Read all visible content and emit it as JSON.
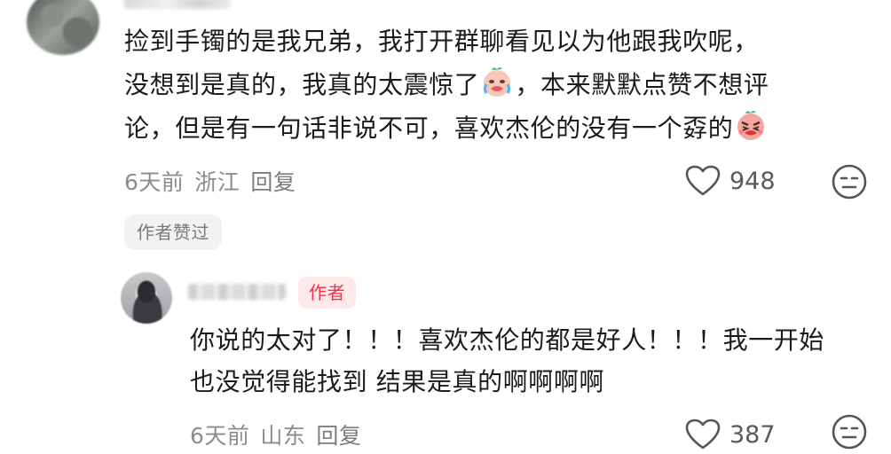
{
  "comment": {
    "line1": "捡到手镯的是我兄弟，我打开群聊看见以为他跟我吹呢，",
    "line2a": "没想到是真的，我真的太震惊了",
    "line2b": "，本来默默点赞不想评",
    "line3a": "论，但是有一句话非说不可，喜欢杰伦的没有一个孬的",
    "time": "6天前",
    "location": "浙江",
    "reply_label": "回复",
    "likes": "948",
    "author_liked_badge": "作者赞过",
    "emoji1": "crying-face",
    "emoji2": "angry-face"
  },
  "reply": {
    "author_tag": "作者",
    "line1": "你说的太对了！！！喜欢杰伦的都是好人！！！我一开始",
    "line2": "也没觉得能找到 结果是真的啊啊啊啊",
    "time": "6天前",
    "location": "山东",
    "reply_label": "回复",
    "likes": "387"
  },
  "icons": {
    "like": "heart-outline-icon",
    "dislike": "neutral-face-icon"
  },
  "colors": {
    "author_tag_text": "#f0354b",
    "author_tag_bg": "#fde8ea",
    "meta_text": "#8c8c8c"
  }
}
